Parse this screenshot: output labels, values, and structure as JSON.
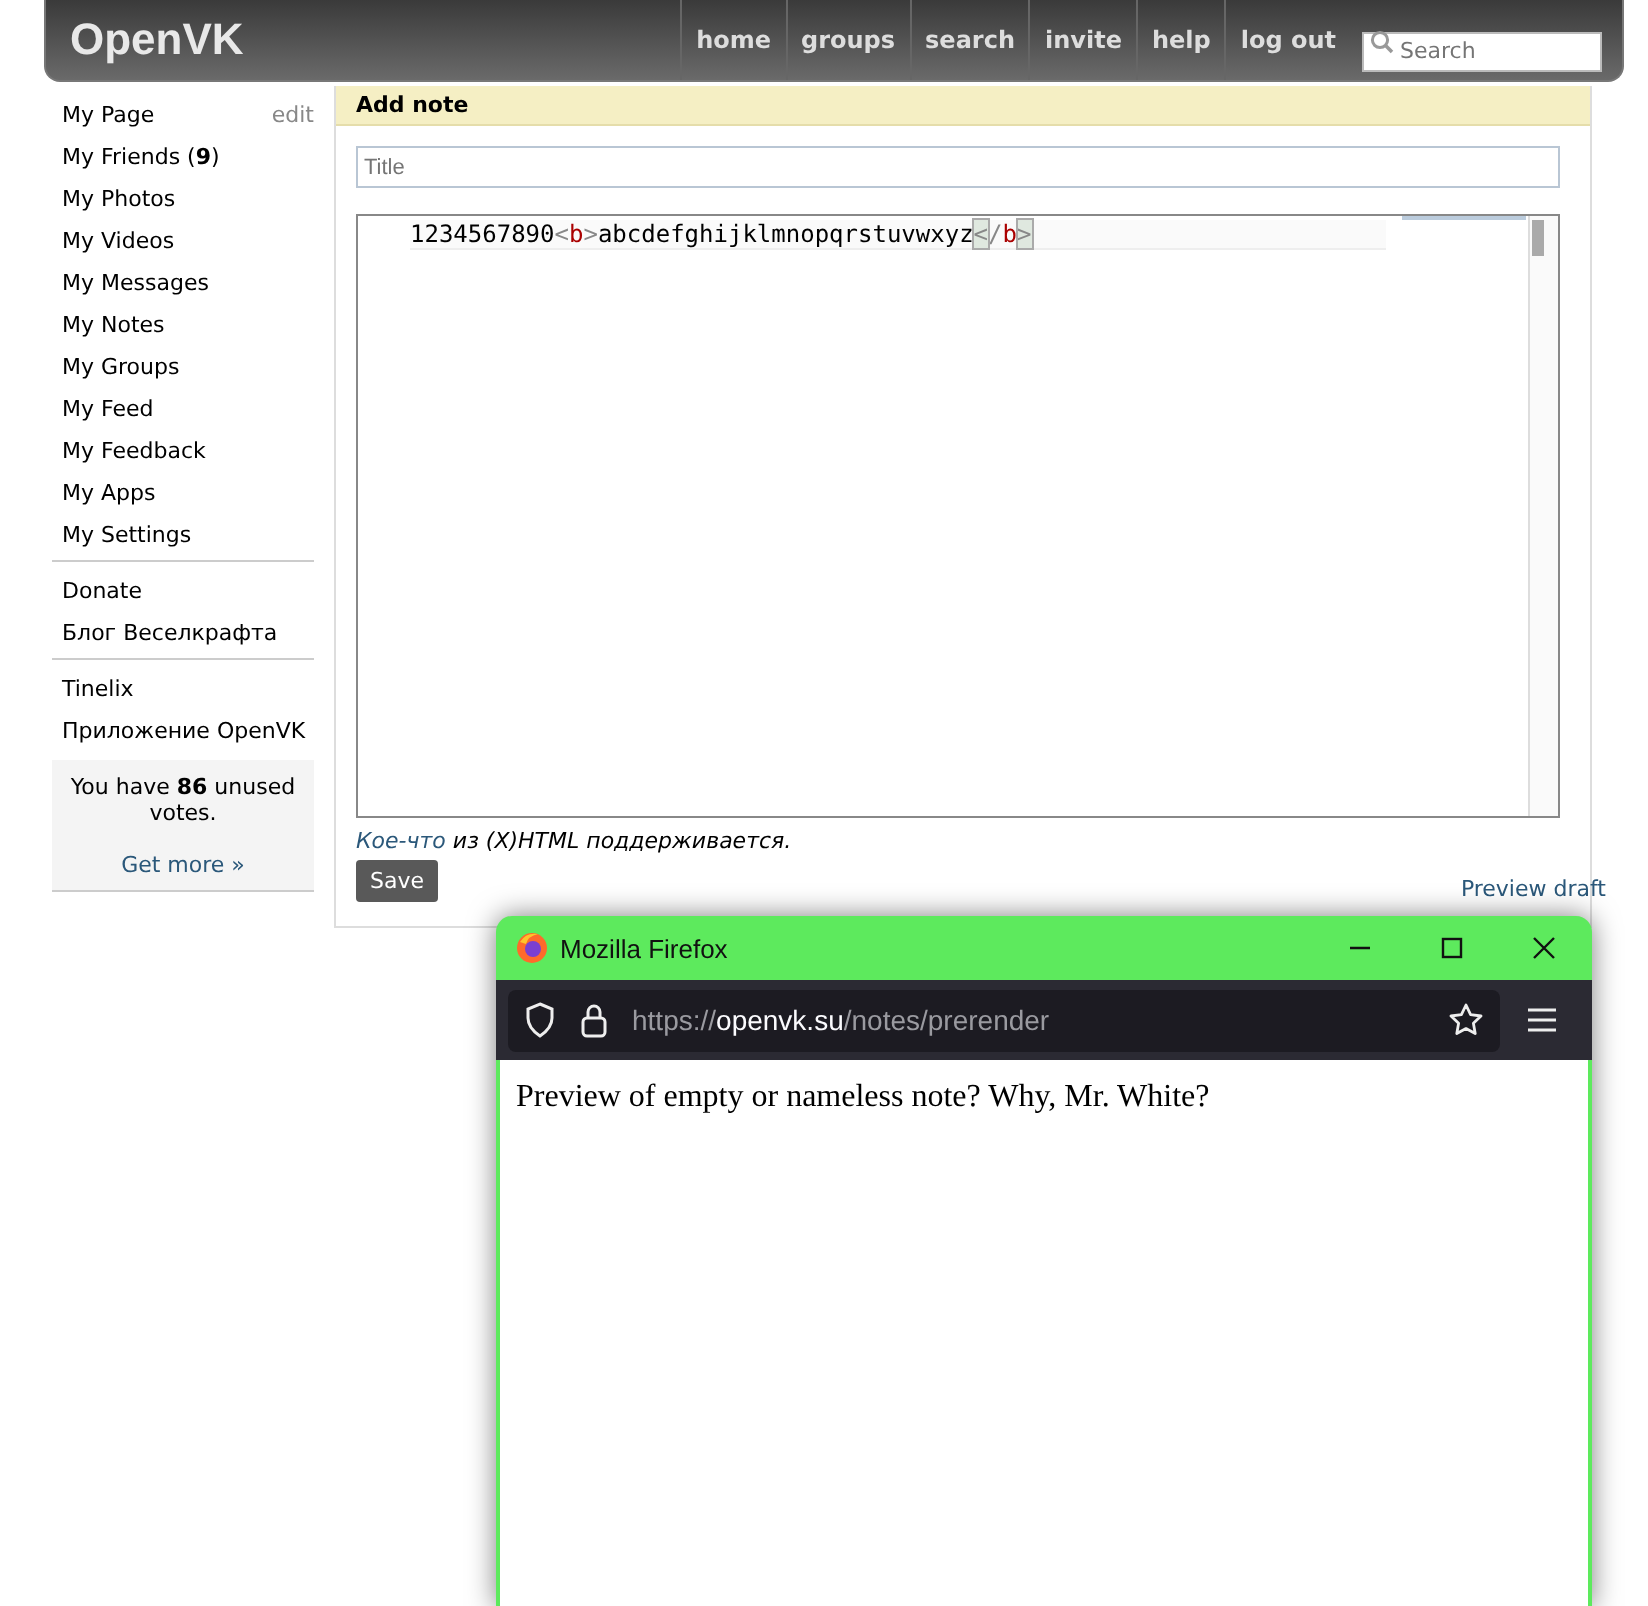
{
  "header": {
    "logo": "OpenVK",
    "nav": [
      "home",
      "groups",
      "search",
      "invite",
      "help",
      "log out"
    ],
    "search": {
      "placeholder": "Search"
    }
  },
  "sidebar": {
    "groups": [
      [
        {
          "label": "My Page",
          "edit": "edit"
        },
        {
          "label": "My Friends (**9**)"
        },
        {
          "label": "My Photos"
        },
        {
          "label": "My Videos"
        },
        {
          "label": "My Messages"
        },
        {
          "label": "My Notes"
        },
        {
          "label": "My Groups"
        },
        {
          "label": "My Feed"
        },
        {
          "label": "My Feedback"
        },
        {
          "label": "My Apps"
        },
        {
          "label": "My Settings"
        }
      ],
      [
        {
          "label": "Donate"
        },
        {
          "label": "Блог Веселкрафта"
        }
      ],
      [
        {
          "label": "Tinelix"
        },
        {
          "label": "Приложение OpenVK"
        }
      ]
    ],
    "votes": {
      "text": "You have **86** unused votes.",
      "link": "Get more »"
    }
  },
  "note_form": {
    "heading": "Add note",
    "title_field": {
      "placeholder": "Title"
    },
    "editor": {
      "line": [
        {
          "kind": "text",
          "text": "1234567890"
        },
        {
          "kind": "bracket",
          "text": "<"
        },
        {
          "kind": "tag",
          "text": "b"
        },
        {
          "kind": "bracket",
          "text": ">"
        },
        {
          "kind": "text",
          "text": "abcdefghijklmnopqrstuvwxyz"
        },
        {
          "kind": "bracket-matched",
          "text": "<"
        },
        {
          "kind": "bracket",
          "text": "/"
        },
        {
          "kind": "tag",
          "text": "b"
        },
        {
          "kind": "bracket-matched",
          "text": ">"
        }
      ]
    },
    "hint": {
      "link": "Кое-что",
      "rest": " из (X)HTML поддерживается."
    },
    "save_button": "Save",
    "preview_link": "Preview draft"
  },
  "browser_window": {
    "title": "Mozilla Firefox",
    "url": {
      "scheme": "https://",
      "host": "openvk.su",
      "path": "/notes/prerender"
    },
    "content": "Preview of empty or nameless note? Why, Mr. White?"
  }
}
